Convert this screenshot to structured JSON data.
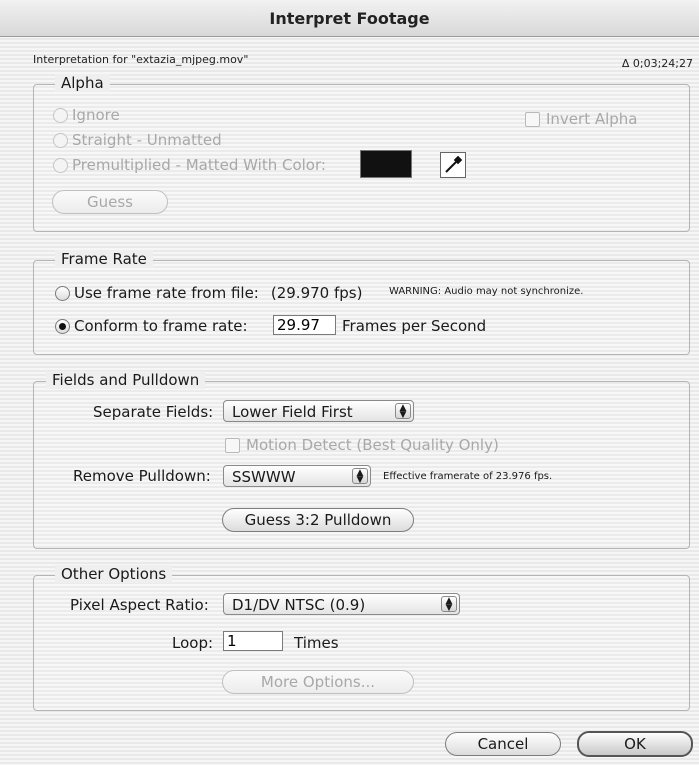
{
  "window": {
    "title": "Interpret Footage"
  },
  "header": {
    "interpretation_for": "Interpretation for \"extazia_mjpeg.mov\"",
    "duration": "Δ 0;03;24;27"
  },
  "alpha": {
    "title": "Alpha",
    "ignore": "Ignore",
    "straight": "Straight - Unmatted",
    "premultiplied": "Premultiplied - Matted With Color:",
    "invert": "Invert Alpha",
    "guess": "Guess",
    "matte_color": "#111111"
  },
  "frame_rate": {
    "title": "Frame Rate",
    "use_from_file": "Use frame rate from file:",
    "file_fps": "(29.970 fps)",
    "warning": "WARNING: Audio may not synchronize.",
    "conform": "Conform to frame rate:",
    "conform_value": "29.97",
    "units": "Frames per Second"
  },
  "fields": {
    "title": "Fields and Pulldown",
    "separate_label": "Separate Fields:",
    "separate_value": "Lower Field First",
    "motion_detect": "Motion Detect (Best Quality Only)",
    "pulldown_label": "Remove Pulldown:",
    "pulldown_value": "SSWWW",
    "effective": "Effective framerate of 23.976 fps.",
    "guess_button": "Guess 3:2 Pulldown"
  },
  "other": {
    "title": "Other Options",
    "par_label": "Pixel Aspect Ratio:",
    "par_value": "D1/DV NTSC (0.9)",
    "loop_label": "Loop:",
    "loop_value": "1",
    "loop_units": "Times",
    "more_options": "More Options..."
  },
  "footer": {
    "cancel": "Cancel",
    "ok": "OK"
  }
}
